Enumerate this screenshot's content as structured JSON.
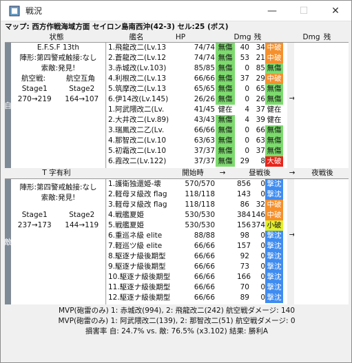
{
  "window": {
    "title": "戦況",
    "minimize": "—",
    "maximize": "☐",
    "close": "✕"
  },
  "map": "マップ: 西方作戦海域方面 セイロン島南西沖(42-3) セル:25 (ボス)",
  "header1": {
    "state": "状態",
    "ships": "艦名",
    "hp": "HP",
    "dmg": "Dmg",
    "remain": "残",
    "dmg2": "Dmg",
    "remain2": "残",
    "arrow": "→"
  },
  "friend": {
    "side": "自",
    "info": [
      "E.F.S.F 13th",
      "陣形:第四警戒",
      "触接:なし",
      "索敵:発見!",
      "航空戦:",
      "航空互角",
      "Stage1",
      "Stage2",
      "270→219",
      "164→107"
    ],
    "rows": [
      {
        "name": "1.飛龍改二(Lv.13",
        "hp": "74/74",
        "st": "無傷",
        "d": "40",
        "r": "34",
        "b": "中破",
        "bc": "orange"
      },
      {
        "name": "2.蒼龍改二(Lv.12",
        "hp": "74/74",
        "st": "無傷",
        "d": "53",
        "r": "21",
        "b": "中破",
        "bc": "orange"
      },
      {
        "name": "3.赤城改(Lv.103)",
        "hp": "85/85",
        "st": "無傷",
        "d": "0",
        "r": "85",
        "b": "無傷",
        "bc": "green"
      },
      {
        "name": "4.利根改二(Lv.13",
        "hp": "66/66",
        "st": "無傷",
        "d": "37",
        "r": "29",
        "b": "中破",
        "bc": "orange"
      },
      {
        "name": "5.筑摩改二(Lv.13",
        "hp": "65/65",
        "st": "無傷",
        "d": "0",
        "r": "65",
        "b": "無傷",
        "bc": "green"
      },
      {
        "name": "6.伊14改(Lv.145)",
        "hp": "26/26",
        "st": "無傷",
        "d": "0",
        "r": "26",
        "b": "無傷",
        "bc": "green"
      },
      {
        "name": "1.阿武隈改二(Lv.",
        "hp": "41/45",
        "st": "健在",
        "d": "4",
        "r": "37",
        "b": "健在",
        "bc": ""
      },
      {
        "name": "2.大井改二(Lv.89)",
        "hp": "43/43",
        "st": "無傷",
        "d": "4",
        "r": "39",
        "b": "健在",
        "bc": ""
      },
      {
        "name": "3.瑞鳳改二乙(Lv.",
        "hp": "66/66",
        "st": "無傷",
        "d": "0",
        "r": "66",
        "b": "無傷",
        "bc": "green"
      },
      {
        "name": "4.那智改二(Lv.10",
        "hp": "63/63",
        "st": "無傷",
        "d": "0",
        "r": "63",
        "b": "無傷",
        "bc": "green"
      },
      {
        "name": "5.初霜改二(Lv.10",
        "hp": "37/37",
        "st": "無傷",
        "d": "0",
        "r": "37",
        "b": "無傷",
        "bc": "green"
      },
      {
        "name": "6.霞改二(Lv.122)",
        "hp": "37/37",
        "st": "無傷",
        "d": "29",
        "r": "8",
        "b": "大破",
        "bc": "red"
      }
    ]
  },
  "header2": {
    "tline": "T 字有利",
    "start": "開始時",
    "day": "昼戦後",
    "night": "夜戦後",
    "arrow": "→"
  },
  "enemy": {
    "side": "敵",
    "info": [
      "陣形:第四警戒",
      "触接:なし",
      "索敵:発見!",
      "Stage1",
      "Stage2",
      "237→173",
      "144→119"
    ],
    "rows": [
      {
        "name": "1.護衛独還姫-壊",
        "hp": "570/570",
        "d": "856",
        "r": "0",
        "b": "撃沈",
        "bc": "blue"
      },
      {
        "name": "2.軽母ヌ級改 flag",
        "hp": "118/118",
        "d": "143",
        "r": "0",
        "b": "撃沈",
        "bc": "blue"
      },
      {
        "name": "3.軽母ヌ級改 flag",
        "hp": "118/118",
        "d": "86",
        "r": "32",
        "b": "中破",
        "bc": "orange"
      },
      {
        "name": "4.戦艦夏姫",
        "hp": "530/530",
        "d": "384",
        "r": "146",
        "b": "中破",
        "bc": "orange"
      },
      {
        "name": "5.戦艦夏姫",
        "hp": "530/530",
        "d": "156",
        "r": "374",
        "b": "小破",
        "bc": "yellow"
      },
      {
        "name": "6.重巡ネ級 elite",
        "hp": "88/88",
        "d": "98",
        "r": "0",
        "b": "撃沈",
        "bc": "blue"
      },
      {
        "name": "7.軽巡ツ級 elite",
        "hp": "66/66",
        "d": "157",
        "r": "0",
        "b": "撃沈",
        "bc": "blue"
      },
      {
        "name": "8.駆逐ナ級後期型",
        "hp": "66/66",
        "d": "92",
        "r": "0",
        "b": "撃沈",
        "bc": "blue"
      },
      {
        "name": "9.駆逐ナ級後期型",
        "hp": "66/66",
        "d": "73",
        "r": "0",
        "b": "撃沈",
        "bc": "blue"
      },
      {
        "name": "10.駆逐ナ級後期型",
        "hp": "66/66",
        "d": "166",
        "r": "0",
        "b": "撃沈",
        "bc": "blue"
      },
      {
        "name": "11.駆逐ナ級後期型",
        "hp": "66/66",
        "d": "70",
        "r": "0",
        "b": "撃沈",
        "bc": "blue"
      },
      {
        "name": "12.駆逐ナ級後期型",
        "hp": "66/66",
        "d": "89",
        "r": "0",
        "b": "撃沈",
        "bc": "blue"
      }
    ]
  },
  "footer": {
    "mvp1": "MVP(砲雷のみ) 1: 赤城改(994), 2: 飛龍改二(242) 航空戦ダメージ: 140",
    "mvp2": "MVP(砲雷のみ) 1: 阿武隈改二(139), 2: 那智改二(51) 航空戦ダメージ: 0",
    "loss": "損害率 自: 24.7% vs. 敵: 76.5% (x3.102) 結果: 勝利A"
  }
}
